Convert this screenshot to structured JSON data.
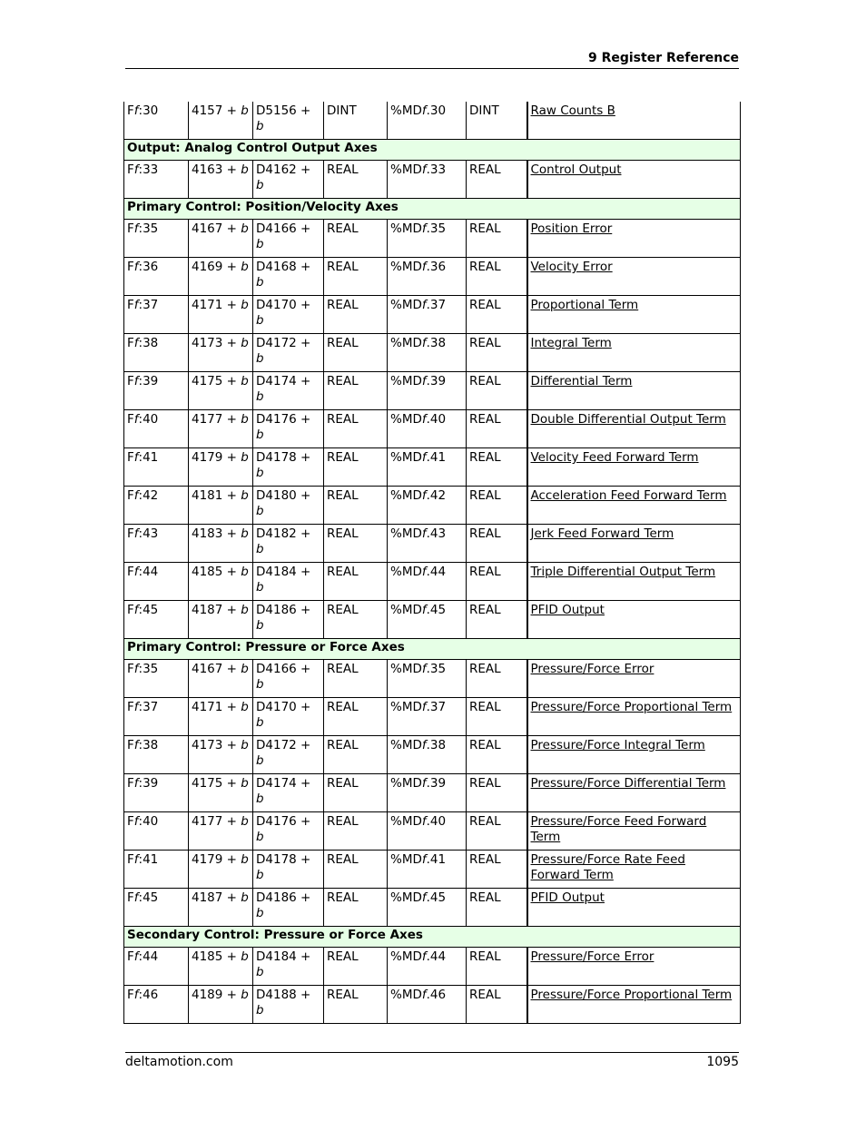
{
  "header": {
    "title": "9  Register Reference"
  },
  "footer": {
    "site": "deltamotion.com",
    "page": "1095"
  },
  "table": {
    "rows": [
      {
        "type": "data",
        "c0": "F",
        "c0b": ":30",
        "c1": "4157 + ",
        "c2": "D5156 + ",
        "c3": "DINT",
        "c4a": "%MD",
        "c4b": ".30",
        "c5": "DINT",
        "desc": "Raw Counts B"
      },
      {
        "type": "section",
        "label": "Output: Analog Control Output Axes"
      },
      {
        "type": "data",
        "c0": "F",
        "c0b": ":33",
        "c1": "4163 + ",
        "c2": "D4162 + ",
        "c3": "REAL",
        "c4a": "%MD",
        "c4b": ".33",
        "c5": "REAL",
        "desc": "Control Output"
      },
      {
        "type": "section",
        "label": "Primary Control: Position/Velocity Axes"
      },
      {
        "type": "data",
        "c0": "F",
        "c0b": ":35",
        "c1": "4167 + ",
        "c2": "D4166 + ",
        "c3": "REAL",
        "c4a": "%MD",
        "c4b": ".35",
        "c5": "REAL",
        "desc": "Position Error"
      },
      {
        "type": "data",
        "c0": "F",
        "c0b": ":36",
        "c1": "4169 + ",
        "c2": "D4168 + ",
        "c3": "REAL",
        "c4a": "%MD",
        "c4b": ".36",
        "c5": "REAL",
        "desc": "Velocity Error"
      },
      {
        "type": "data",
        "c0": "F",
        "c0b": ":37",
        "c1": "4171 + ",
        "c2": "D4170 + ",
        "c3": "REAL",
        "c4a": "%MD",
        "c4b": ".37",
        "c5": "REAL",
        "desc": "Proportional Term"
      },
      {
        "type": "data",
        "c0": "F",
        "c0b": ":38",
        "c1": "4173 + ",
        "c2": "D4172 + ",
        "c3": "REAL",
        "c4a": "%MD",
        "c4b": ".38",
        "c5": "REAL",
        "desc": "Integral Term"
      },
      {
        "type": "data",
        "c0": "F",
        "c0b": ":39",
        "c1": "4175 + ",
        "c2": "D4174 + ",
        "c3": "REAL",
        "c4a": "%MD",
        "c4b": ".39",
        "c5": "REAL",
        "desc": "Differential Term"
      },
      {
        "type": "data",
        "c0": "F",
        "c0b": ":40",
        "c1": "4177 + ",
        "c2": "D4176 + ",
        "c3": "REAL",
        "c4a": "%MD",
        "c4b": ".40",
        "c5": "REAL",
        "desc": "Double Differential Output Term"
      },
      {
        "type": "data",
        "c0": "F",
        "c0b": ":41",
        "c1": "4179 + ",
        "c2": "D4178 + ",
        "c3": "REAL",
        "c4a": "%MD",
        "c4b": ".41",
        "c5": "REAL",
        "desc": "Velocity Feed Forward Term"
      },
      {
        "type": "data",
        "c0": "F",
        "c0b": ":42",
        "c1": "4181 + ",
        "c2": "D4180 + ",
        "c3": "REAL",
        "c4a": "%MD",
        "c4b": ".42",
        "c5": "REAL",
        "desc": "Acceleration Feed Forward Term"
      },
      {
        "type": "data",
        "c0": "F",
        "c0b": ":43",
        "c1": "4183 + ",
        "c2": "D4182 + ",
        "c3": "REAL",
        "c4a": "%MD",
        "c4b": ".43",
        "c5": "REAL",
        "desc": "Jerk Feed Forward Term"
      },
      {
        "type": "data",
        "c0": "F",
        "c0b": ":44",
        "c1": "4185 + ",
        "c2": "D4184 + ",
        "c3": "REAL",
        "c4a": "%MD",
        "c4b": ".44",
        "c5": "REAL",
        "desc": "Triple Differential Output Term"
      },
      {
        "type": "data",
        "c0": "F",
        "c0b": ":45",
        "c1": "4187 + ",
        "c2": "D4186 + ",
        "c3": "REAL",
        "c4a": "%MD",
        "c4b": ".45",
        "c5": "REAL",
        "desc": "PFID Output"
      },
      {
        "type": "section",
        "label": "Primary Control: Pressure or Force Axes"
      },
      {
        "type": "data",
        "c0": "F",
        "c0b": ":35",
        "c1": "4167 + ",
        "c2": "D4166 + ",
        "c3": "REAL",
        "c4a": "%MD",
        "c4b": ".35",
        "c5": "REAL",
        "desc": "Pressure/Force Error"
      },
      {
        "type": "data",
        "c0": "F",
        "c0b": ":37",
        "c1": "4171 + ",
        "c2": "D4170 + ",
        "c3": "REAL",
        "c4a": "%MD",
        "c4b": ".37",
        "c5": "REAL",
        "desc": "Pressure/Force Proportional Term"
      },
      {
        "type": "data",
        "c0": "F",
        "c0b": ":38",
        "c1": "4173 + ",
        "c2": "D4172 + ",
        "c3": "REAL",
        "c4a": "%MD",
        "c4b": ".38",
        "c5": "REAL",
        "desc": "Pressure/Force Integral Term"
      },
      {
        "type": "data",
        "c0": "F",
        "c0b": ":39",
        "c1": "4175 + ",
        "c2": "D4174 + ",
        "c3": "REAL",
        "c4a": "%MD",
        "c4b": ".39",
        "c5": "REAL",
        "desc": "Pressure/Force Differential Term"
      },
      {
        "type": "data",
        "c0": "F",
        "c0b": ":40",
        "c1": "4177 + ",
        "c2": "D4176 + ",
        "c3": "REAL",
        "c4a": "%MD",
        "c4b": ".40",
        "c5": "REAL",
        "desc": "Pressure/Force Feed Forward Term"
      },
      {
        "type": "data",
        "c0": "F",
        "c0b": ":41",
        "c1": "4179 + ",
        "c2": "D4178 + ",
        "c3": "REAL",
        "c4a": "%MD",
        "c4b": ".41",
        "c5": "REAL",
        "desc": "Pressure/Force Rate Feed Forward Term"
      },
      {
        "type": "data",
        "c0": "F",
        "c0b": ":45",
        "c1": "4187 + ",
        "c2": "D4186 + ",
        "c3": "REAL",
        "c4a": "%MD",
        "c4b": ".45",
        "c5": "REAL",
        "desc": "PFID Output"
      },
      {
        "type": "section",
        "label": "Secondary Control: Pressure or Force Axes"
      },
      {
        "type": "data",
        "c0": "F",
        "c0b": ":44",
        "c1": "4185 + ",
        "c2": "D4184 + ",
        "c3": "REAL",
        "c4a": "%MD",
        "c4b": ".44",
        "c5": "REAL",
        "desc": "Pressure/Force Error"
      },
      {
        "type": "data",
        "c0": "F",
        "c0b": ":46",
        "c1": "4189 + ",
        "c2": "D4188 + ",
        "c3": "REAL",
        "c4a": "%MD",
        "c4b": ".46",
        "c5": "REAL",
        "desc": "Pressure/Force Proportional Term"
      }
    ],
    "var_f": "f",
    "var_b": "b"
  }
}
